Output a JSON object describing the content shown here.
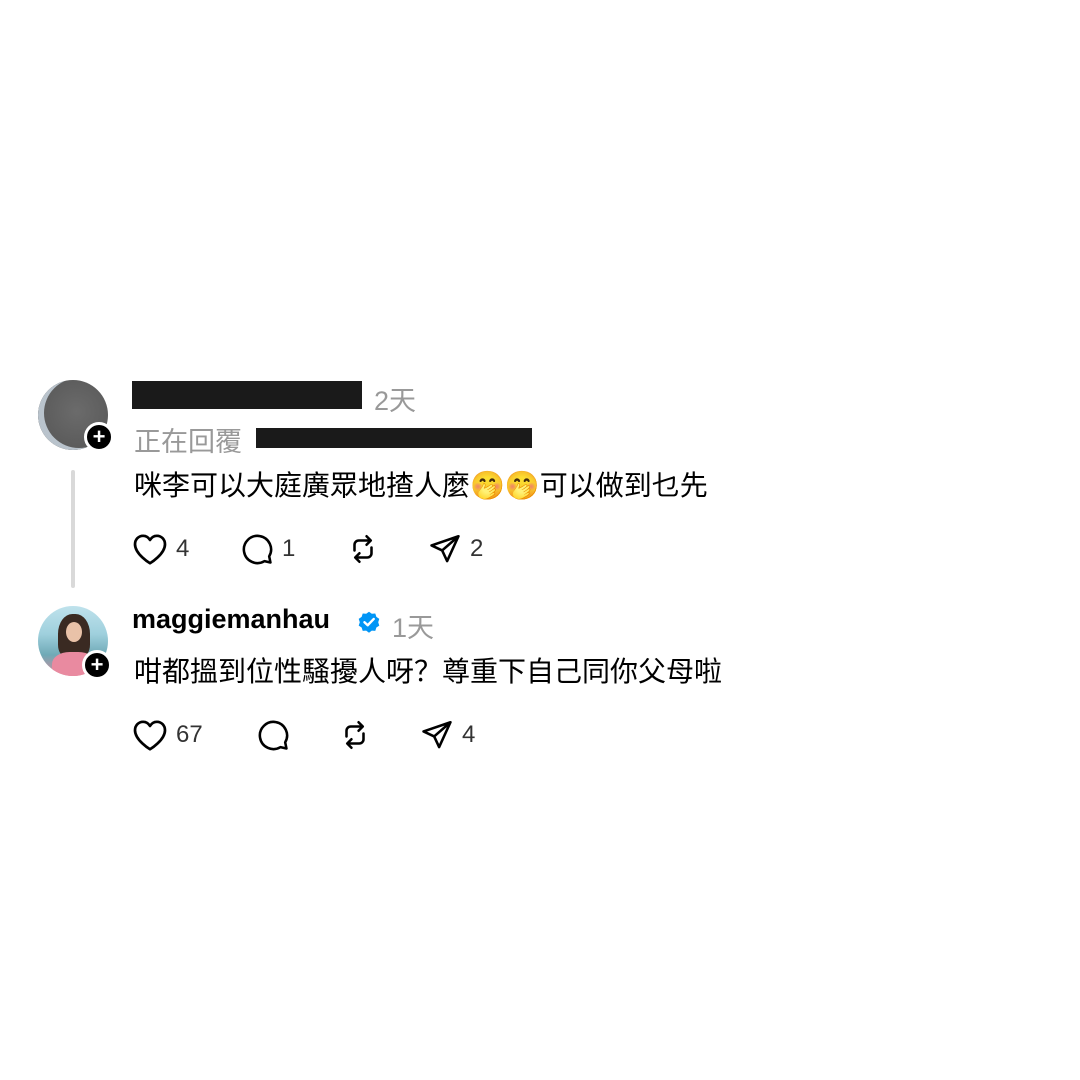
{
  "comments": [
    {
      "time": "2天",
      "reply_prefix": "正在回覆",
      "text": "咪李可以大庭廣眾地揸人麼🤭🤭可以做到乜先",
      "likes": "4",
      "replies": "1",
      "reposts": "",
      "shares": "2"
    },
    {
      "username": "maggiemanhau",
      "verified": true,
      "time": "1天",
      "text": "咁都搵到位性騷擾人呀？尊重下自己同你父母啦",
      "likes": "67",
      "replies": "",
      "reposts": "",
      "shares": "4"
    }
  ],
  "colors": {
    "verified_blue": "#0095f6",
    "meta_gray": "#999999",
    "thread_line": "#d9d9d9"
  },
  "icons": [
    "heart-icon",
    "comment-icon",
    "repost-icon",
    "share-icon",
    "plus-icon",
    "verified-icon"
  ]
}
